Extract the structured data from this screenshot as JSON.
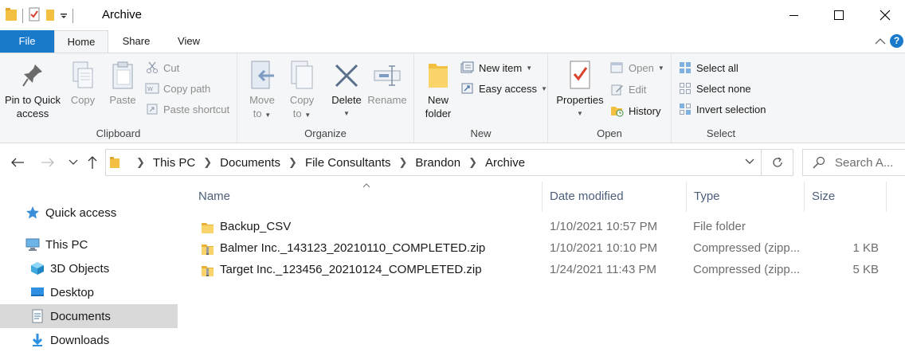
{
  "window": {
    "title": "Archive"
  },
  "ribbon_tabs": {
    "file": "File",
    "home": "Home",
    "share": "Share",
    "view": "View",
    "help": "?"
  },
  "clipboard": {
    "group_label": "Clipboard",
    "pin_line1": "Pin to Quick",
    "pin_line2": "access",
    "copy": "Copy",
    "paste": "Paste",
    "cut": "Cut",
    "copy_path": "Copy path",
    "paste_shortcut": "Paste shortcut"
  },
  "organize": {
    "group_label": "Organize",
    "move_line1": "Move",
    "move_line2": "to",
    "copy_line1": "Copy",
    "copy_line2": "to",
    "delete": "Delete",
    "rename": "Rename"
  },
  "new": {
    "group_label": "New",
    "new_folder_line1": "New",
    "new_folder_line2": "folder",
    "new_item": "New item",
    "easy_access": "Easy access"
  },
  "open": {
    "group_label": "Open",
    "properties": "Properties",
    "open": "Open",
    "edit": "Edit",
    "history": "History"
  },
  "select": {
    "group_label": "Select",
    "select_all": "Select all",
    "select_none": "Select none",
    "invert_selection": "Invert selection"
  },
  "address": {
    "crumbs": [
      "This PC",
      "Documents",
      "File Consultants",
      "Brandon",
      "Archive"
    ],
    "search_placeholder": "Search A..."
  },
  "sidebar": {
    "items": [
      {
        "label": "Quick access",
        "icon": "star-icon"
      },
      {
        "label": "This PC",
        "icon": "computer-icon"
      },
      {
        "label": "3D Objects",
        "icon": "cube-icon"
      },
      {
        "label": "Desktop",
        "icon": "desktop-icon"
      },
      {
        "label": "Documents",
        "icon": "document-icon",
        "selected": true
      },
      {
        "label": "Downloads",
        "icon": "download-arrow-icon"
      }
    ]
  },
  "file_list": {
    "columns": {
      "name": "Name",
      "date_modified": "Date modified",
      "type": "Type",
      "size": "Size"
    },
    "rows": [
      {
        "name": "Backup_CSV",
        "date": "1/10/2021 10:57 PM",
        "type": "File folder",
        "size": "",
        "icon": "folder-icon"
      },
      {
        "name": "Balmer Inc._143123_20210110_COMPLETED.zip",
        "date": "1/10/2021 10:10 PM",
        "type": "Compressed (zipp...",
        "size": "1 KB",
        "icon": "zip-folder-icon"
      },
      {
        "name": "Target Inc._123456_20210124_COMPLETED.zip",
        "date": "1/24/2021 11:43 PM",
        "type": "Compressed (zipp...",
        "size": "5 KB",
        "icon": "zip-folder-icon"
      }
    ]
  },
  "colors": {
    "accent": "#1979ca",
    "folder": "#f4c041",
    "selected": "#d9d9d9"
  }
}
